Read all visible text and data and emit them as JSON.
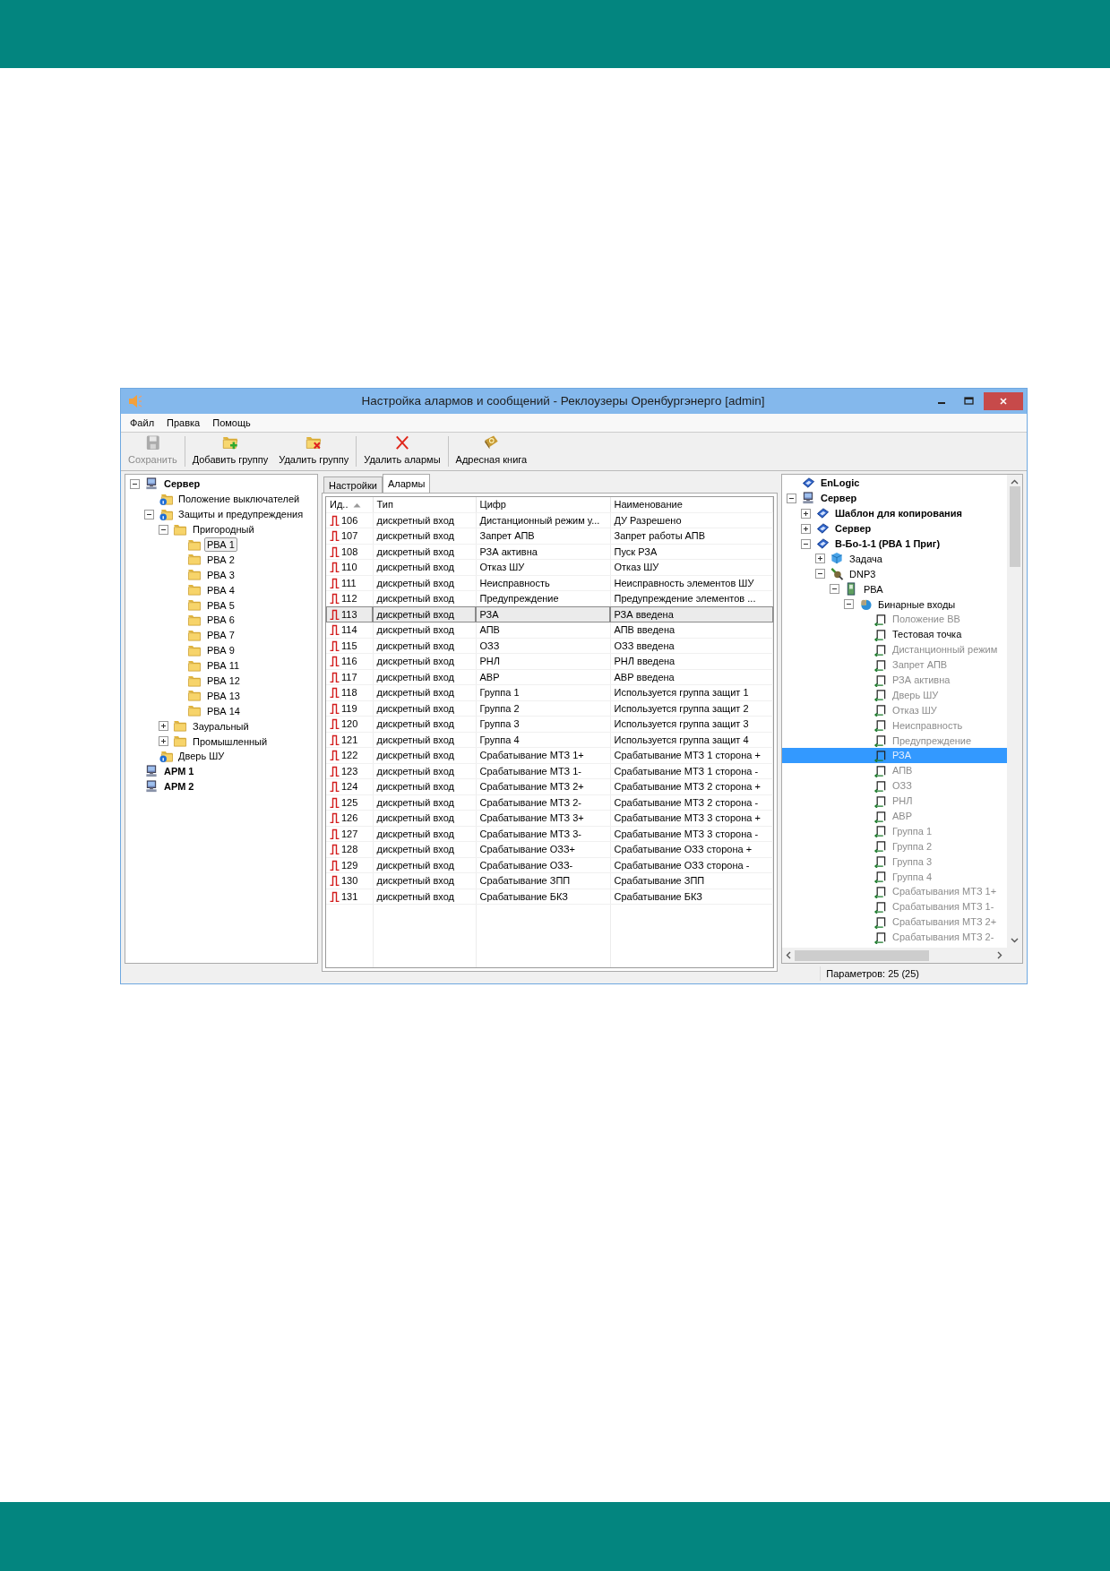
{
  "window": {
    "title": "Настройка алармов и сообщений - Реклоузеры Оренбургэнерго [admin]"
  },
  "menu": [
    "Файл",
    "Правка",
    "Помощь"
  ],
  "toolbar": [
    {
      "label": "Сохранить",
      "kind": "save",
      "disabled": true,
      "separator_before": false
    },
    {
      "label": "Добавить группу",
      "kind": "add-group",
      "disabled": false,
      "separator_before": true
    },
    {
      "label": "Удалить группу",
      "kind": "remove-group",
      "disabled": false,
      "separator_before": false
    },
    {
      "label": "Удалить алармы",
      "kind": "remove-alarms",
      "disabled": false,
      "separator_before": true
    },
    {
      "label": "Адресная книга",
      "kind": "address-book",
      "disabled": false,
      "separator_before": true
    }
  ],
  "left_tree": {
    "items": [
      {
        "label": "Сервер",
        "kind": "server",
        "expanded": true,
        "selected": false,
        "children": [
          {
            "label": "Положение выключателей",
            "kind": "info-folder",
            "selected": false
          },
          {
            "label": "Защиты и предупреждения",
            "kind": "info-folder",
            "expanded": true,
            "selected": false,
            "children": [
              {
                "label": "Пригородный",
                "kind": "folder",
                "expanded": true,
                "selected": false,
                "children": [
                  {
                    "label": "РВА 1",
                    "kind": "folder",
                    "selected": true
                  },
                  {
                    "label": "РВА 2",
                    "kind": "folder",
                    "selected": false
                  },
                  {
                    "label": "РВА 3",
                    "kind": "folder",
                    "selected": false
                  },
                  {
                    "label": "РВА 4",
                    "kind": "folder",
                    "selected": false
                  },
                  {
                    "label": "РВА 5",
                    "kind": "folder",
                    "selected": false
                  },
                  {
                    "label": "РВА 6",
                    "kind": "folder",
                    "selected": false
                  },
                  {
                    "label": "РВА 7",
                    "kind": "folder",
                    "selected": false
                  },
                  {
                    "label": "РВА 9",
                    "kind": "folder",
                    "selected": false
                  },
                  {
                    "label": "РВА 11",
                    "kind": "folder",
                    "selected": false
                  },
                  {
                    "label": "РВА 12",
                    "kind": "folder",
                    "selected": false
                  },
                  {
                    "label": "РВА 13",
                    "kind": "folder",
                    "selected": false
                  },
                  {
                    "label": "РВА 14",
                    "kind": "folder",
                    "selected": false
                  }
                ]
              },
              {
                "label": "Зауральный",
                "kind": "folder",
                "expanded": false,
                "selected": false
              },
              {
                "label": "Промышленный",
                "kind": "folder",
                "expanded": false,
                "selected": false
              }
            ]
          },
          {
            "label": "Дверь ШУ",
            "kind": "info-folder",
            "selected": false
          }
        ]
      },
      {
        "label": "АРМ 1",
        "kind": "server",
        "selected": false
      },
      {
        "label": "АРМ 2",
        "kind": "server",
        "selected": false
      }
    ]
  },
  "tabs": [
    {
      "label": "Настройки",
      "selected": false
    },
    {
      "label": "Алармы",
      "selected": true
    }
  ],
  "table": {
    "columns": [
      {
        "label": "Ид..",
        "sorted": true
      },
      {
        "label": "Тип",
        "sorted": false
      },
      {
        "label": "Цифр",
        "sorted": false
      },
      {
        "label": "Наименование",
        "sorted": false
      }
    ],
    "rows": [
      {
        "id": "106",
        "type": "дискретный вход",
        "cifr": "Дистанционный режим у...",
        "name": "ДУ Разрешено",
        "selected": false
      },
      {
        "id": "107",
        "type": "дискретный вход",
        "cifr": "Запрет АПВ",
        "name": "Запрет работы АПВ",
        "selected": false
      },
      {
        "id": "108",
        "type": "дискретный вход",
        "cifr": "РЗА активна",
        "name": "Пуск РЗА",
        "selected": false
      },
      {
        "id": "110",
        "type": "дискретный вход",
        "cifr": "Отказ ШУ",
        "name": "Отказ ШУ",
        "selected": false
      },
      {
        "id": "111",
        "type": "дискретный вход",
        "cifr": "Неисправность",
        "name": "Неисправность элементов ШУ",
        "selected": false
      },
      {
        "id": "112",
        "type": "дискретный вход",
        "cifr": "Предупреждение",
        "name": "Предупреждение элементов ...",
        "selected": false
      },
      {
        "id": "113",
        "type": "дискретный вход",
        "cifr": "РЗА",
        "name": "РЗА введена",
        "selected": true
      },
      {
        "id": "114",
        "type": "дискретный вход",
        "cifr": "АПВ",
        "name": "АПВ введена",
        "selected": false
      },
      {
        "id": "115",
        "type": "дискретный вход",
        "cifr": "ОЗЗ",
        "name": "ОЗЗ введена",
        "selected": false
      },
      {
        "id": "116",
        "type": "дискретный вход",
        "cifr": "РНЛ",
        "name": "РНЛ введена",
        "selected": false
      },
      {
        "id": "117",
        "type": "дискретный вход",
        "cifr": "АВР",
        "name": "АВР введена",
        "selected": false
      },
      {
        "id": "118",
        "type": "дискретный вход",
        "cifr": "Группа 1",
        "name": "Используется группа защит 1",
        "selected": false
      },
      {
        "id": "119",
        "type": "дискретный вход",
        "cifr": "Группа 2",
        "name": "Используется группа защит 2",
        "selected": false
      },
      {
        "id": "120",
        "type": "дискретный вход",
        "cifr": "Группа 3",
        "name": "Используется группа защит 3",
        "selected": false
      },
      {
        "id": "121",
        "type": "дискретный вход",
        "cifr": "Группа 4",
        "name": "Используется группа защит 4",
        "selected": false
      },
      {
        "id": "122",
        "type": "дискретный вход",
        "cifr": "Срабатывание МТЗ 1+",
        "name": "Срабатывание МТЗ 1 сторона +",
        "selected": false
      },
      {
        "id": "123",
        "type": "дискретный вход",
        "cifr": "Срабатывание МТЗ 1-",
        "name": "Срабатывание МТЗ 1 сторона -",
        "selected": false
      },
      {
        "id": "124",
        "type": "дискретный вход",
        "cifr": "Срабатывание МТЗ 2+",
        "name": "Срабатывание МТЗ 2 сторона +",
        "selected": false
      },
      {
        "id": "125",
        "type": "дискретный вход",
        "cifr": "Срабатывание МТЗ 2-",
        "name": "Срабатывание МТЗ 2 сторона -",
        "selected": false
      },
      {
        "id": "126",
        "type": "дискретный вход",
        "cifr": "Срабатывание МТЗ 3+",
        "name": "Срабатывание МТЗ 3 сторона +",
        "selected": false
      },
      {
        "id": "127",
        "type": "дискретный вход",
        "cifr": "Срабатывание МТЗ 3-",
        "name": "Срабатывание МТЗ 3 сторона -",
        "selected": false
      },
      {
        "id": "128",
        "type": "дискретный вход",
        "cifr": "Срабатывание ОЗЗ+",
        "name": "Срабатывание ОЗЗ сторона +",
        "selected": false
      },
      {
        "id": "129",
        "type": "дискретный вход",
        "cifr": "Срабатывание ОЗЗ-",
        "name": "Срабатывание ОЗЗ сторона -",
        "selected": false
      },
      {
        "id": "130",
        "type": "дискретный вход",
        "cifr": "Срабатывание ЗПП",
        "name": "Срабатывание ЗПП",
        "selected": false
      },
      {
        "id": "131",
        "type": "дискретный вход",
        "cifr": "Срабатывание БКЗ",
        "name": "Срабатывание БКЗ",
        "selected": false
      }
    ]
  },
  "right_tree": {
    "items": [
      {
        "label": "EnLogic",
        "kind": "device",
        "selected": false
      },
      {
        "label": "Сервер",
        "kind": "server",
        "expanded": true,
        "selected": false,
        "children": [
          {
            "label": "Шаблон для копирования",
            "kind": "device",
            "expanded": false,
            "selected": false
          },
          {
            "label": "Сервер",
            "kind": "device",
            "expanded": false,
            "selected": false
          },
          {
            "label": "В-Бо-1-1 (РВА 1 Приг)",
            "kind": "device",
            "expanded": true,
            "selected": false,
            "children": [
              {
                "label": "Задача",
                "kind": "task",
                "expanded": false,
                "selected": false
              },
              {
                "label": "DNP3",
                "kind": "protocol",
                "expanded": true,
                "selected": false,
                "children": [
                  {
                    "label": "РВА",
                    "kind": "module",
                    "expanded": true,
                    "selected": false,
                    "children": [
                      {
                        "label": "Бинарные входы",
                        "kind": "group",
                        "expanded": true,
                        "selected": false,
                        "children": [
                          {
                            "label": "Положение ВВ",
                            "kind": "point",
                            "disabled": true,
                            "selected": false
                          },
                          {
                            "label": "Тестовая точка",
                            "kind": "point",
                            "disabled": false,
                            "selected": false
                          },
                          {
                            "label": "Дистанционный режим",
                            "kind": "point",
                            "disabled": true,
                            "selected": false
                          },
                          {
                            "label": "Запрет АПВ",
                            "kind": "point",
                            "disabled": true,
                            "selected": false
                          },
                          {
                            "label": "РЗА активна",
                            "kind": "point",
                            "disabled": true,
                            "selected": false
                          },
                          {
                            "label": "Дверь ШУ",
                            "kind": "point",
                            "disabled": true,
                            "selected": false
                          },
                          {
                            "label": "Отказ ШУ",
                            "kind": "point",
                            "disabled": true,
                            "selected": false
                          },
                          {
                            "label": "Неисправность",
                            "kind": "point",
                            "disabled": true,
                            "selected": false
                          },
                          {
                            "label": "Предупреждение",
                            "kind": "point",
                            "disabled": true,
                            "selected": false
                          },
                          {
                            "label": "РЗА",
                            "kind": "point",
                            "disabled": true,
                            "selected": true
                          },
                          {
                            "label": "АПВ",
                            "kind": "point",
                            "disabled": true,
                            "selected": false
                          },
                          {
                            "label": "ОЗЗ",
                            "kind": "point",
                            "disabled": true,
                            "selected": false
                          },
                          {
                            "label": "РНЛ",
                            "kind": "point",
                            "disabled": true,
                            "selected": false
                          },
                          {
                            "label": "АВР",
                            "kind": "point",
                            "disabled": true,
                            "selected": false
                          },
                          {
                            "label": "Группа 1",
                            "kind": "point",
                            "disabled": true,
                            "selected": false
                          },
                          {
                            "label": "Группа 2",
                            "kind": "point",
                            "disabled": true,
                            "selected": false
                          },
                          {
                            "label": "Группа 3",
                            "kind": "point",
                            "disabled": true,
                            "selected": false
                          },
                          {
                            "label": "Группа 4",
                            "kind": "point",
                            "disabled": true,
                            "selected": false
                          },
                          {
                            "label": "Срабатывания МТЗ 1+",
                            "kind": "point",
                            "disabled": true,
                            "selected": false
                          },
                          {
                            "label": "Срабатывания МТЗ 1-",
                            "kind": "point",
                            "disabled": true,
                            "selected": false
                          },
                          {
                            "label": "Срабатывания МТЗ 2+",
                            "kind": "point",
                            "disabled": true,
                            "selected": false
                          },
                          {
                            "label": "Срабатывания МТЗ 2-",
                            "kind": "point",
                            "disabled": true,
                            "selected": false
                          }
                        ]
                      }
                    ]
                  }
                ]
              }
            ]
          }
        ]
      }
    ]
  },
  "status_bar": {
    "text": "Параметров: 25 (25)"
  }
}
